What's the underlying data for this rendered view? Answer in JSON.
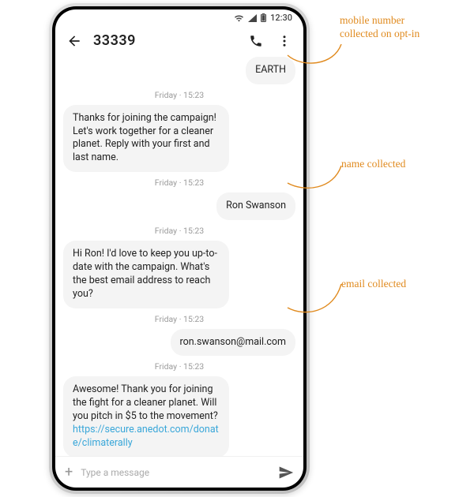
{
  "status": {
    "time": "12:30"
  },
  "header": {
    "title": "33339"
  },
  "timestamps": [
    "Friday · 15:23",
    "Friday · 15:23",
    "Friday · 15:23",
    "Friday · 15:23",
    "Friday · 15:23",
    "Friday · 15:23"
  ],
  "messages": {
    "m0": "EARTH",
    "m1": "Thanks for joining the campaign! Let's work together for a cleaner planet. Reply with your first and last name.",
    "m2": "Ron Swanson",
    "m3": "Hi Ron! I'd love to keep you up-to-date with the campaign. What's the best email address to reach you?",
    "m4": "ron.swanson@mail.com",
    "m5_text": "Awesome! Thank you for joining the fight for a cleaner planet. Will you pitch in $5 to the movement?",
    "m5_link": "https://secure.anedot.com/donate/climaterally"
  },
  "input": {
    "placeholder": "Type a message"
  },
  "annotations": {
    "a1": "mobile number collected on opt-in",
    "a2": "name collected",
    "a3": "email collected"
  }
}
